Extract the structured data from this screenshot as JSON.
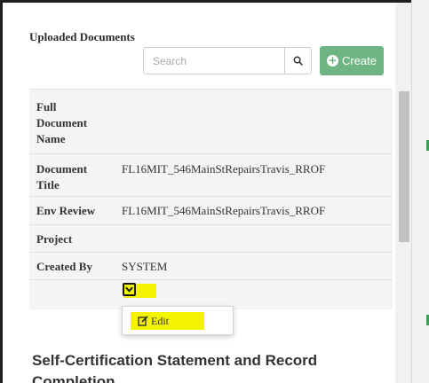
{
  "panel": {
    "title": "Uploaded Documents"
  },
  "search": {
    "placeholder": "Search",
    "icon": "search-icon"
  },
  "create_button": {
    "label": "Create",
    "icon": "plus-circle-icon",
    "color": "#6fb583"
  },
  "details": {
    "rows": [
      {
        "label": "Full Document Name",
        "value": ""
      },
      {
        "label": "Document Title",
        "value": "FL16MIT_546MainStRepairsTravis_RROF"
      },
      {
        "label": "Env Review",
        "value": "FL16MIT_546MainStRepairsTravis_RROF"
      },
      {
        "label": "Project",
        "value": ""
      },
      {
        "label": "Created By",
        "value": "SYSTEM"
      }
    ]
  },
  "actions_menu": {
    "toggle_icon": "chevron-down-icon",
    "items": [
      {
        "label": "Edit",
        "icon": "edit-icon"
      }
    ],
    "highlight_color": "#f4f400"
  },
  "next_section": {
    "title_line1": "Self-Certification Statement and Record",
    "title_line2": "Completion"
  }
}
